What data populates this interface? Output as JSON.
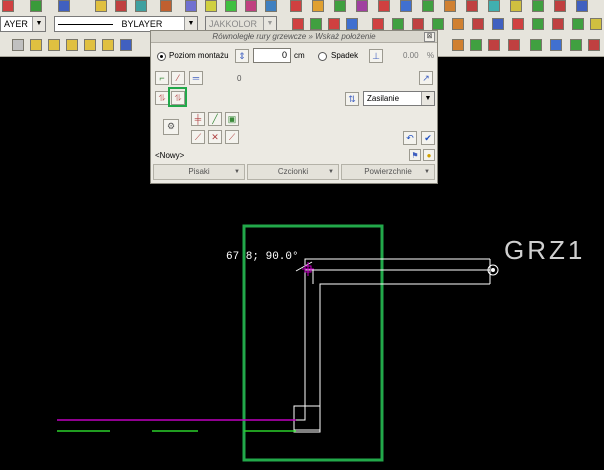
{
  "toolbar": {
    "layer_value": "AYER",
    "linetype_value": "BYLAYER",
    "color_value": "JAKKOLOR"
  },
  "dialog": {
    "title": "Równoległe rury grzewcze » Wskaż położenie",
    "close_glyph": "⊠",
    "radio_level_label": "Poziom montażu",
    "level_value": "0",
    "level_unit": "cm",
    "radio_slope_label": "Spadek",
    "slope_value": "0.00",
    "slope_unit": "%",
    "counter_value": "0",
    "supply_value": "Zasilanie",
    "new_label": "<Nowy>",
    "tabs": [
      "Pisaki",
      "Czcionki",
      "Powierzchnie"
    ]
  },
  "drawing": {
    "coord_label": "67 8;  90.0°",
    "grz_label": "GRZ1"
  },
  "colors": {
    "highlight": "#22a84a",
    "pipe": "#ffffff",
    "magenta": "#c000c0",
    "green_line": "#2bd02b"
  }
}
